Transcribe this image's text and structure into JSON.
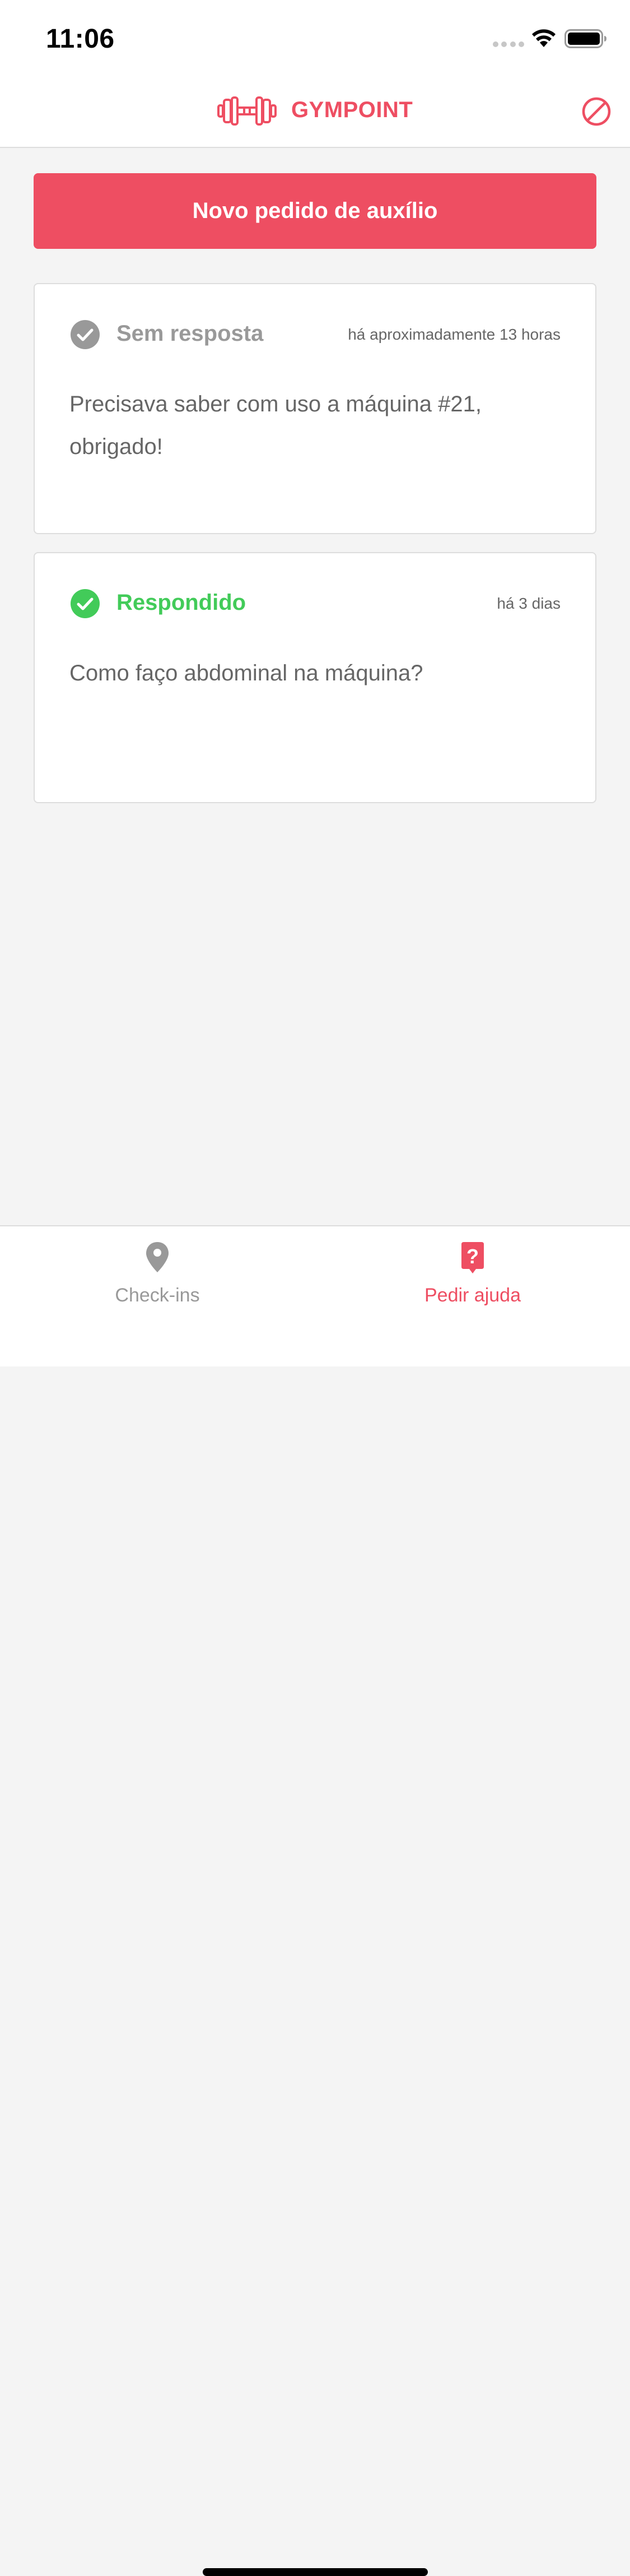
{
  "status_bar": {
    "time": "11:06"
  },
  "header": {
    "brand": "GYMPOINT",
    "logo_icon": "dumbbell-icon",
    "logout_icon": "block-icon",
    "accent_color": "#ee4e62"
  },
  "actions": {
    "new_request_label": "Novo pedido de auxílio"
  },
  "help_orders": [
    {
      "status": "Sem resposta",
      "status_icon": "check-circle-icon",
      "status_color": "#999999",
      "time": "há aproximadamente 13 horas",
      "question": "Precisava saber com uso a máquina #21, obrigado!"
    },
    {
      "status": "Respondido",
      "status_icon": "check-circle-icon",
      "status_color": "#42cb59",
      "time": "há 3 dias",
      "question": "Como faço abdominal na máquina?"
    }
  ],
  "tab_bar": {
    "items": [
      {
        "label": "Check-ins",
        "icon": "location-pin-icon",
        "active": false
      },
      {
        "label": "Pedir ajuda",
        "icon": "help-bubble-icon",
        "active": true
      }
    ]
  }
}
